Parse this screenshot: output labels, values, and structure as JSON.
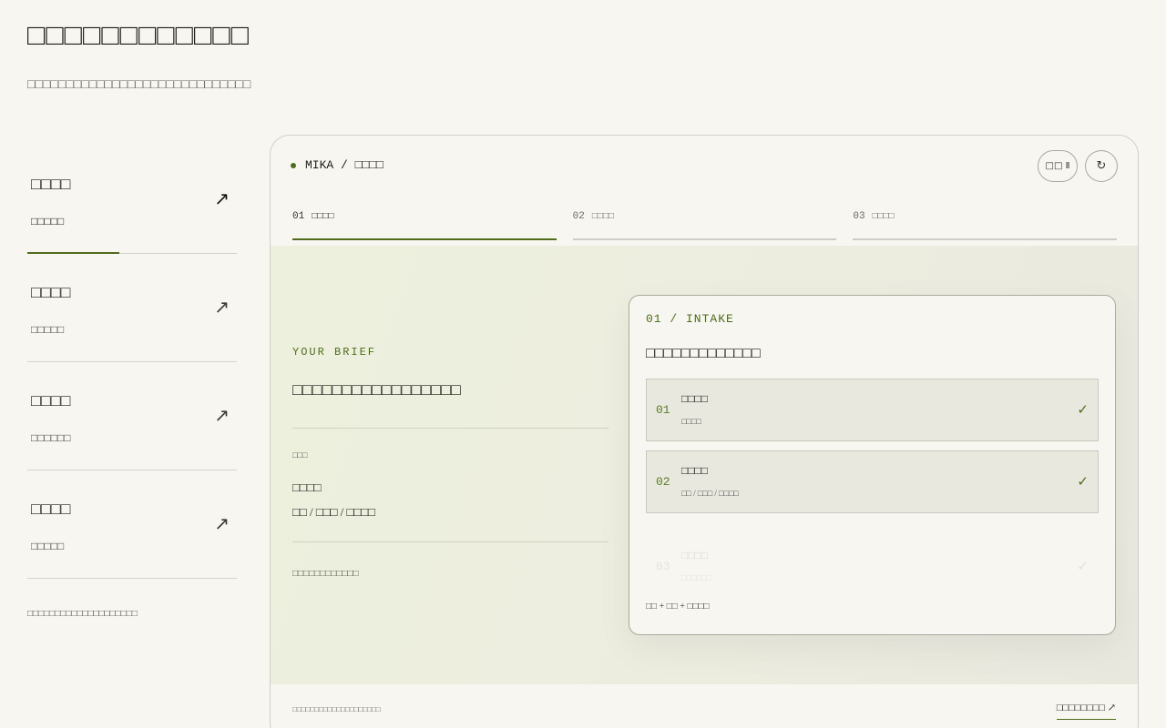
{
  "page": {
    "title": "□□□□□□□□□□□□",
    "subtitle": "□□□□□□□□□□□□□□□□□□□□□□□□□□□□□"
  },
  "sidebar": {
    "items": [
      {
        "title": "□□□□",
        "subtitle": "□□□□□",
        "arrow": "↗"
      },
      {
        "title": "□□□□",
        "subtitle": "□□□□□",
        "arrow": "↗"
      },
      {
        "title": "□□□□",
        "subtitle": "□□□□□□",
        "arrow": "↗"
      },
      {
        "title": "□□□□",
        "subtitle": "□□□□□",
        "arrow": "↗"
      }
    ],
    "note": "□□□□□□□□□□□□□□□□□□□□"
  },
  "panel": {
    "breadcrumb": "MIKA / □□□□",
    "pause_label": "□□ Ⅱ",
    "refresh_label": "↻",
    "steps": [
      {
        "num": "01",
        "label": "□□□□"
      },
      {
        "num": "02",
        "label": "□□□□"
      },
      {
        "num": "03",
        "label": "□□□□"
      }
    ],
    "brief": {
      "kicker": "YOUR BRIEF",
      "title": "□□□□□□□□□□□□□□□□□",
      "label": "□□□",
      "value1": "□□□□",
      "value2": "□□ / □□□ / □□□□",
      "note": "□□□□□□□□□□□□"
    },
    "card": {
      "kicker": "01 / INTAKE",
      "title": "□□□□□□□□□□□□□",
      "options": [
        {
          "num": "01",
          "title": "□□□□",
          "subtitle": "□□□□",
          "check": "✓"
        },
        {
          "num": "02",
          "title": "□□□□",
          "subtitle": "□□ / □□□ / □□□□",
          "check": "✓"
        },
        {
          "num": "03",
          "title": "□□□□",
          "subtitle": "□□□□□□",
          "check": "✓"
        }
      ],
      "footer": "□□ + □□ + □□□□"
    },
    "footer_note": "□□□□□□□□□□□□□□□□□□□□",
    "footer_link": "□□□□□□□□ ↗"
  },
  "colors": {
    "accent": "#4f6b1c",
    "background": "#f7f6f1",
    "stage": "#ecefdc"
  }
}
